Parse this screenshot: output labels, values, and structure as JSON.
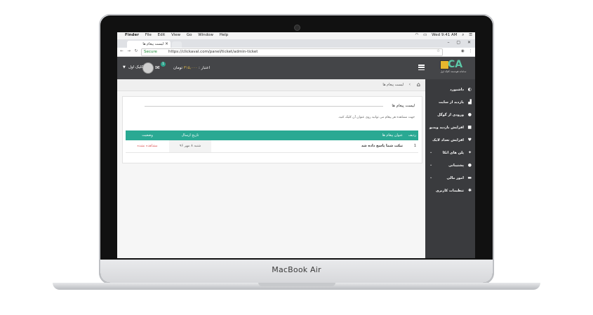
{
  "device": {
    "brand": "MacBook Air"
  },
  "mac_menubar": {
    "app": "Finder",
    "menus": [
      "File",
      "Edit",
      "View",
      "Go",
      "Window",
      "Help"
    ],
    "clock": "Wed 9:41 AM"
  },
  "browser": {
    "tab_title": "لیست پیغام ها",
    "secure_label": "Secure",
    "url": "https://clickaval.com/panel/ticket/admin-ticket"
  },
  "header": {
    "logo_text": "CA",
    "logo_subtitle": "سامانه هوشمند کلیک اول",
    "credit_label": "اعتبار :",
    "credit_amount": "۳۱۵,۰۰۰",
    "credit_unit": "تومان",
    "user_name": "کلیک اول",
    "mail_badge": "1"
  },
  "sidebar": {
    "items": [
      {
        "label": "داشبورد",
        "icon": "dashboard-icon"
      },
      {
        "label": "بازدید از سایت",
        "icon": "chart-icon"
      },
      {
        "label": "ورودی از گوگل",
        "icon": "google-icon"
      },
      {
        "label": "افزایش بازدید ویدیو",
        "icon": "video-icon"
      },
      {
        "label": "افزایش تعداد لایک",
        "icon": "heart-icon"
      },
      {
        "label": "پلن های اتکا",
        "icon": "plan-icon",
        "expandable": true
      },
      {
        "label": "پشتیبانی",
        "icon": "support-icon",
        "expandable": true
      },
      {
        "label": "امور مالی",
        "icon": "card-icon",
        "expandable": true
      },
      {
        "label": "تنظیمات کاربری",
        "icon": "settings-icon"
      }
    ]
  },
  "breadcrumb": {
    "current": "لیست پیغام ها"
  },
  "main": {
    "card_title": "لیست پیغام ها",
    "help_text": "جهت مشاهده هر پیغام می توانید روی عنوان آن کلیک کنید.",
    "columns": {
      "index": "ردیف",
      "subject": "عنوان پیغام ها",
      "date": "تاریخ ارسال",
      "status": "وضعیت"
    },
    "rows": [
      {
        "index": "1",
        "subject": "تیکت شما پاسخ داده شد",
        "date": "شنبه ۸ مهر ۹۶",
        "status": "مشاهده نشده"
      }
    ]
  }
}
